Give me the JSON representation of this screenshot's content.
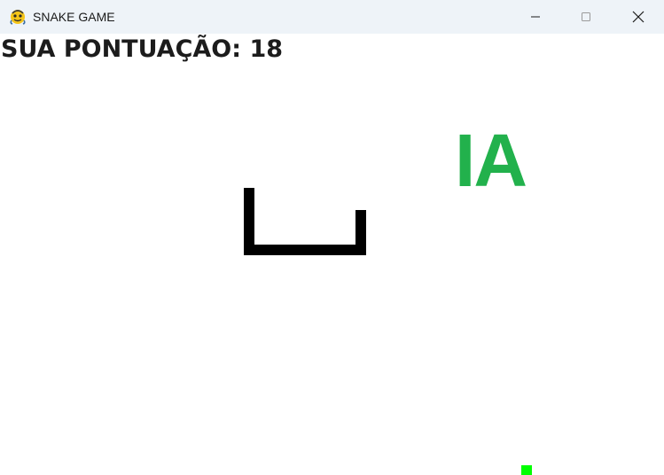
{
  "window": {
    "title": "SNAKE GAME",
    "icon": "pygame-snake-icon",
    "controls": [
      "minimize-icon",
      "maximize-icon",
      "close-icon"
    ]
  },
  "hud": {
    "score_text": "SUA PONTUAÇÃO: 18"
  },
  "overlay": {
    "label": "IA",
    "label_color": "#22b14c"
  },
  "snake": {
    "color": "#000000",
    "length_segments": 18
  },
  "food": {
    "color": "#00ff00"
  },
  "colors": {
    "background": "#ffffff",
    "titlebar": "#eef3f8"
  }
}
